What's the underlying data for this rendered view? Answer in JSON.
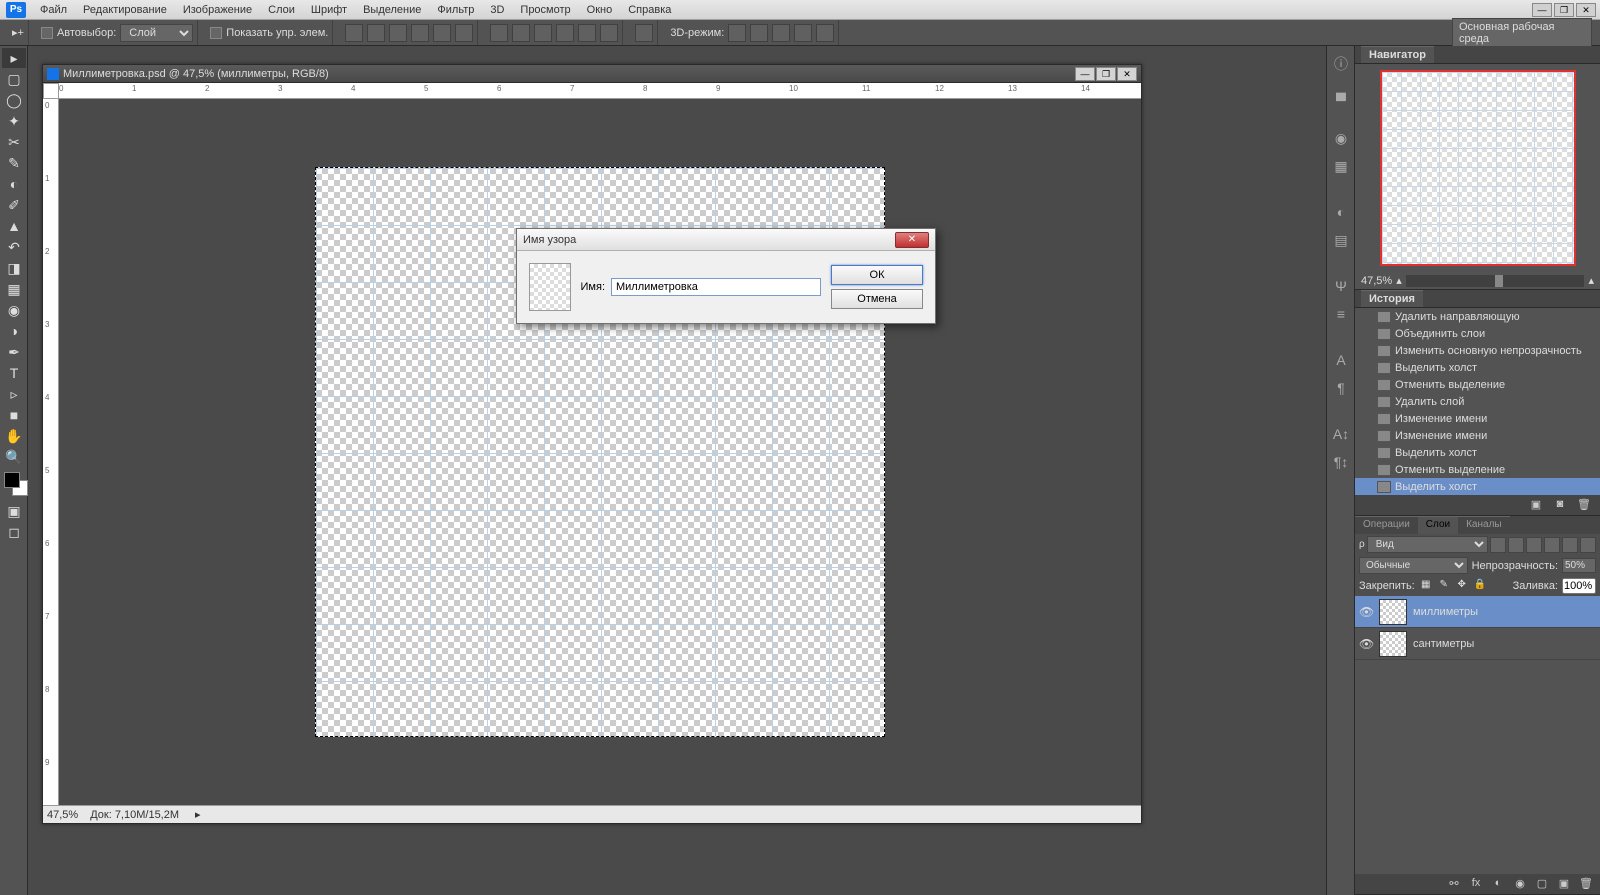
{
  "app": {
    "logo": "Ps"
  },
  "menu": [
    "Файл",
    "Редактирование",
    "Изображение",
    "Слои",
    "Шрифт",
    "Выделение",
    "Фильтр",
    "3D",
    "Просмотр",
    "Окно",
    "Справка"
  ],
  "options": {
    "autoselect_label": "Автовыбор:",
    "autoselect_target": "Слой",
    "show_controls_label": "Показать упр. элем.",
    "mode_3d_label": "3D-режим:",
    "workspace": "Основная рабочая среда"
  },
  "document": {
    "title": "Миллиметровка.psd @ 47,5% (миллиметры, RGB/8)",
    "zoom": "47,5%",
    "doc_size": "Док: 7,10M/15,2M",
    "ruler_marks_h": [
      "0",
      "1",
      "2",
      "3",
      "4",
      "5",
      "6",
      "7",
      "8",
      "9",
      "10",
      "11",
      "12",
      "13",
      "14"
    ],
    "ruler_marks_v": [
      "0",
      "1",
      "2",
      "3",
      "4",
      "5",
      "6",
      "7",
      "8",
      "9"
    ]
  },
  "navigator": {
    "title": "Навигатор",
    "zoom": "47,5%"
  },
  "history": {
    "title": "История",
    "items": [
      "Удалить направляющую",
      "Объединить слои",
      "Изменить основную непрозрачность",
      "Выделить холст",
      "Отменить выделение",
      "Удалить слой",
      "Изменение имени",
      "Изменение имени",
      "Выделить холст",
      "Отменить выделение",
      "Выделить холст"
    ],
    "active_index": 10
  },
  "layers": {
    "tabs": [
      "Операции",
      "Слои",
      "Каналы"
    ],
    "active_tab": 1,
    "filter_label": "Вид",
    "blend_mode": "Обычные",
    "opacity_label": "Непрозрачность:",
    "opacity_value": "50%",
    "lock_label": "Закрепить:",
    "fill_label": "Заливка:",
    "fill_value": "100%",
    "items": [
      {
        "name": "миллиметры",
        "visible": true,
        "selected": true
      },
      {
        "name": "сантиметры",
        "visible": true,
        "selected": false
      }
    ]
  },
  "dialog": {
    "title": "Имя узора",
    "name_label": "Имя:",
    "name_value": "Миллиметровка",
    "ok": "ОК",
    "cancel": "Отмена"
  }
}
